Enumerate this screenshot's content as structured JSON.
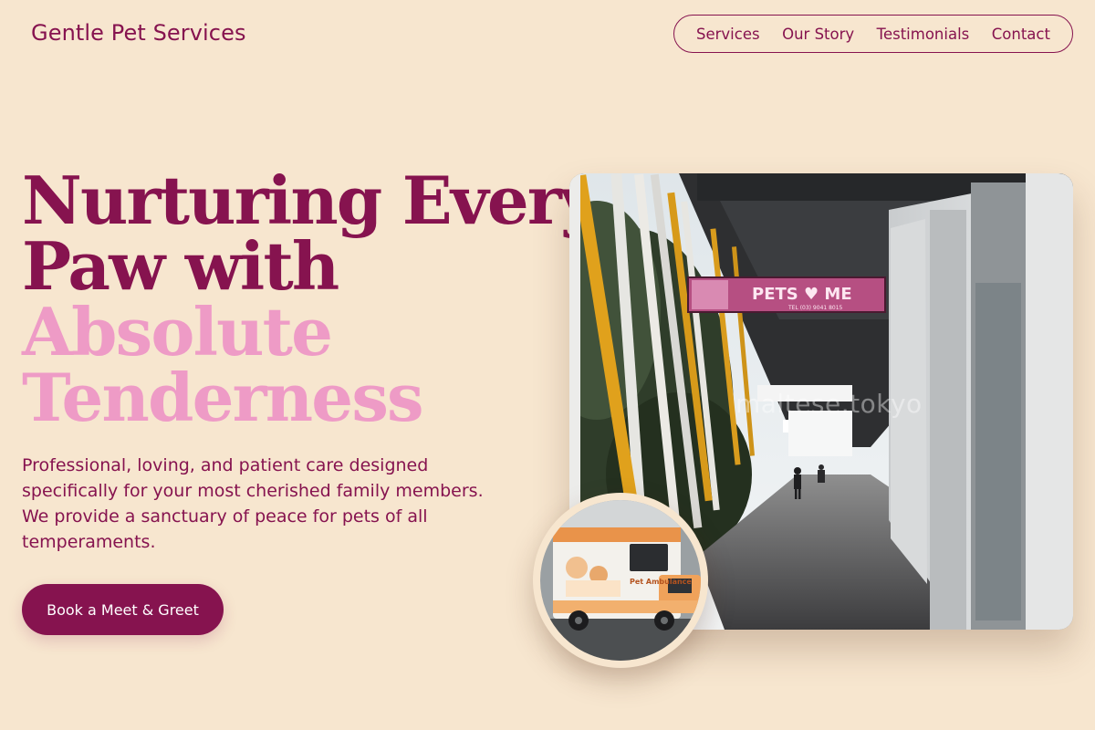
{
  "header": {
    "brand": "Gentle Pet Services",
    "nav": [
      {
        "label": "Services"
      },
      {
        "label": "Our Story"
      },
      {
        "label": "Testimonials"
      },
      {
        "label": "Contact"
      }
    ]
  },
  "hero": {
    "title_lines": [
      "Nurturing Every",
      "Paw with",
      "Absolute",
      "Tenderness"
    ],
    "description": "Professional, loving, and patient care designed specifically for your most cherished family members. We provide a sanctuary of peace for pets of all temperaments.",
    "cta_label": "Book a Meet & Greet"
  },
  "images": {
    "main_photo_watermark": "maltese.tokyo",
    "sign_text": "PETS ♥ ME",
    "sign_phone": "TEL (03) 9041 8015",
    "van_text": "Pet Ambulance"
  },
  "colors": {
    "background": "#f7e6cf",
    "primary": "#86134f",
    "accent_pink": "#ee9bc6",
    "button_text": "#ffffff"
  }
}
